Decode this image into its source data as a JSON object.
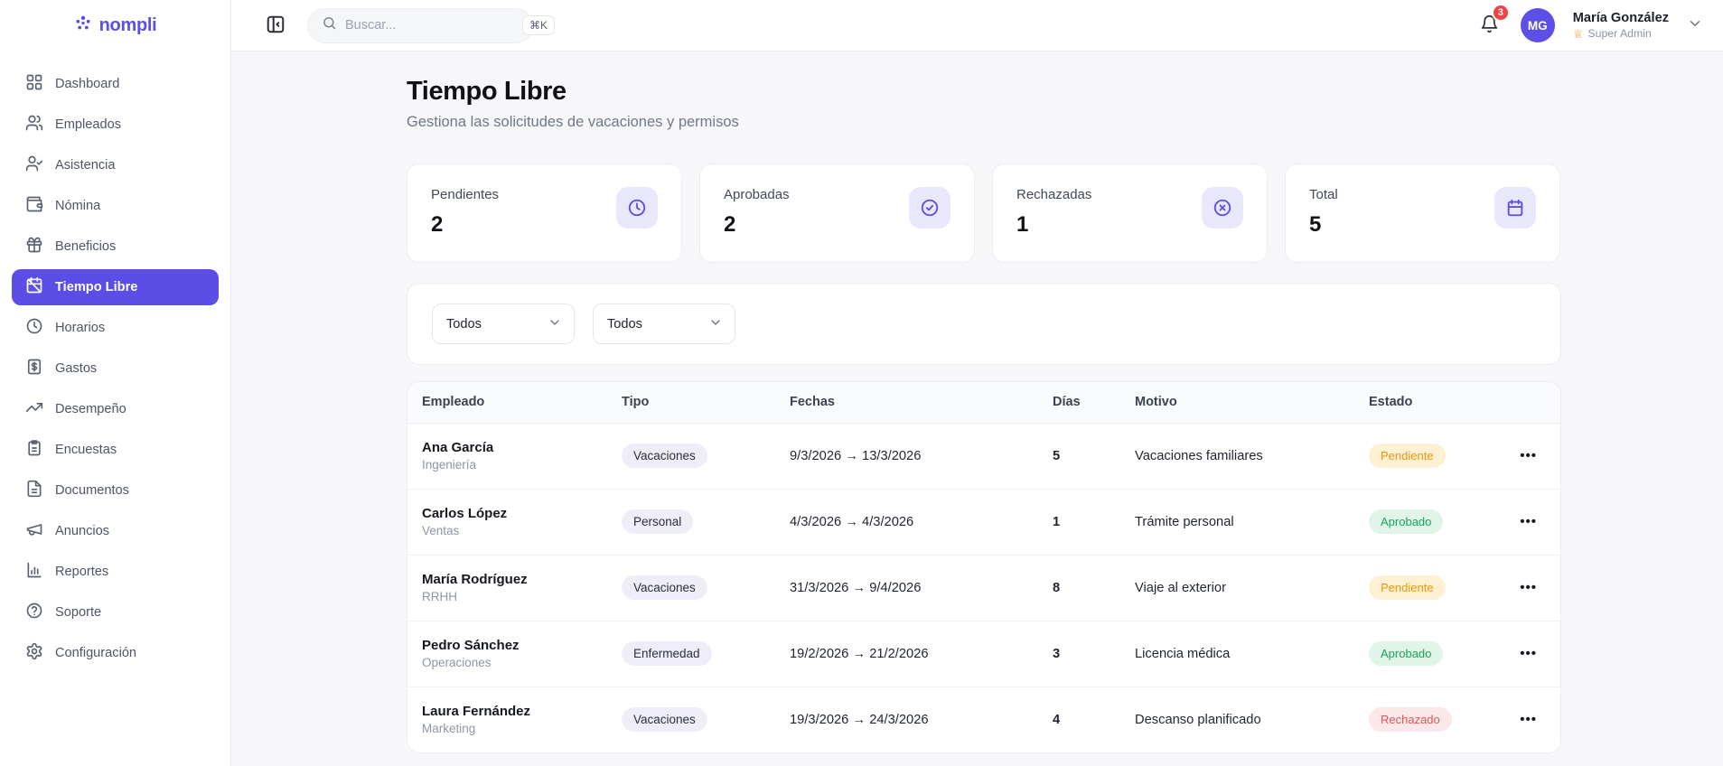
{
  "brand": {
    "name": "nompli",
    "accent_color": "#5b4fe8"
  },
  "header": {
    "search": {
      "placeholder": "Buscar...",
      "shortcut": "⌘K"
    },
    "notifications": {
      "count": "3",
      "badge_color": "#ef4444"
    },
    "user": {
      "initials": "MG",
      "name": "María González",
      "role": "Super Admin"
    }
  },
  "sidebar": {
    "items": [
      {
        "label": "Dashboard",
        "icon": "grid-icon",
        "active": false
      },
      {
        "label": "Empleados",
        "icon": "users-icon",
        "active": false
      },
      {
        "label": "Asistencia",
        "icon": "user-check-icon",
        "active": false
      },
      {
        "label": "Nómina",
        "icon": "wallet-icon",
        "active": false
      },
      {
        "label": "Beneficios",
        "icon": "gift-icon",
        "active": false
      },
      {
        "label": "Tiempo Libre",
        "icon": "calendar-off-icon",
        "active": true
      },
      {
        "label": "Horarios",
        "icon": "clock-icon",
        "active": false
      },
      {
        "label": "Gastos",
        "icon": "receipt-icon",
        "active": false
      },
      {
        "label": "Desempeño",
        "icon": "trending-up-icon",
        "active": false
      },
      {
        "label": "Encuestas",
        "icon": "clipboard-icon",
        "active": false
      },
      {
        "label": "Documentos",
        "icon": "file-text-icon",
        "active": false
      },
      {
        "label": "Anuncios",
        "icon": "megaphone-icon",
        "active": false
      },
      {
        "label": "Reportes",
        "icon": "bar-chart-icon",
        "active": false
      },
      {
        "label": "Soporte",
        "icon": "help-circle-icon",
        "active": false
      },
      {
        "label": "Configuración",
        "icon": "gear-icon",
        "active": false
      }
    ]
  },
  "page": {
    "title": "Tiempo Libre",
    "subtitle": "Gestiona las solicitudes de vacaciones y permisos"
  },
  "stats": [
    {
      "label": "Pendientes",
      "value": "2",
      "icon": "clock-icon"
    },
    {
      "label": "Aprobadas",
      "value": "2",
      "icon": "check-circle-icon"
    },
    {
      "label": "Rechazadas",
      "value": "1",
      "icon": "x-circle-icon"
    },
    {
      "label": "Total",
      "value": "5",
      "icon": "calendar-icon"
    }
  ],
  "filters": {
    "type": {
      "value": "Todos"
    },
    "status": {
      "value": "Todos"
    }
  },
  "table": {
    "columns": [
      "Empleado",
      "Tipo",
      "Fechas",
      "Días",
      "Motivo",
      "Estado"
    ],
    "rows": [
      {
        "name": "Ana García",
        "dept": "Ingeniería",
        "type": "Vacaciones",
        "dates": "9/3/2026 → 13/3/2026",
        "days": "5",
        "reason": "Vacaciones familiares",
        "status": "Pendiente",
        "status_kind": "pendiente",
        "menu": "•••"
      },
      {
        "name": "Carlos López",
        "dept": "Ventas",
        "type": "Personal",
        "dates": "4/3/2026 → 4/3/2026",
        "days": "1",
        "reason": "Trámite personal",
        "status": "Aprobado",
        "status_kind": "aprobado",
        "menu": "•••"
      },
      {
        "name": "María Rodríguez",
        "dept": "RRHH",
        "type": "Vacaciones",
        "dates": "31/3/2026 → 9/4/2026",
        "days": "8",
        "reason": "Viaje al exterior",
        "status": "Pendiente",
        "status_kind": "pendiente",
        "menu": "•••"
      },
      {
        "name": "Pedro Sánchez",
        "dept": "Operaciones",
        "type": "Enfermedad",
        "dates": "19/2/2026 → 21/2/2026",
        "days": "3",
        "reason": "Licencia médica",
        "status": "Aprobado",
        "status_kind": "aprobado",
        "menu": "•••"
      },
      {
        "name": "Laura Fernández",
        "dept": "Marketing",
        "type": "Vacaciones",
        "dates": "19/3/2026 → 24/3/2026",
        "days": "4",
        "reason": "Descanso planificado",
        "status": "Rechazado",
        "status_kind": "rechazado",
        "menu": "•••"
      }
    ]
  },
  "status_colors": {
    "pendiente": "#e8960c",
    "aprobado": "#17a45c",
    "rechazado": "#e25555"
  }
}
